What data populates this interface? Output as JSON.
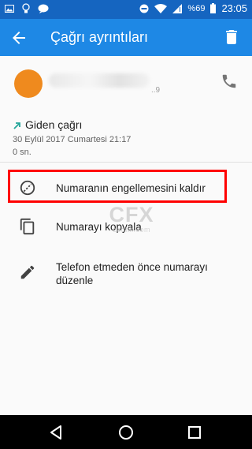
{
  "status_bar": {
    "battery_percent": "%69",
    "time": "23:05",
    "icons": [
      "image-icon",
      "lightbulb-icon",
      "messenger-icon",
      "do-not-disturb-icon",
      "wifi-icon",
      "signal-icon",
      "battery-icon"
    ]
  },
  "app_bar": {
    "title": "Çağrı ayrıntıları",
    "back_icon": "arrow-back-icon",
    "delete_icon": "trash-icon"
  },
  "contact": {
    "avatar_color": "#ef8a1e",
    "number_partial": "..9"
  },
  "call": {
    "type": "Giden çağrı",
    "type_color": "#26a69a",
    "date": "30 Eylül 2017 Cumartesi 21:17",
    "duration": "0 sn."
  },
  "actions": [
    {
      "label": "Numaranın engellemesini kaldır",
      "icon": "unblock-icon",
      "highlighted": true
    },
    {
      "label": "Numarayı kopyala",
      "icon": "copy-icon"
    },
    {
      "label": "Telefon etmeden önce numarayı düzenle",
      "icon": "edit-pencil-icon"
    }
  ],
  "watermark": {
    "logo": "CFX",
    "site": "ceofix.com"
  },
  "nav_bar": {
    "back": "nav-back-icon",
    "home": "nav-home-icon",
    "recents": "nav-recents-icon"
  },
  "colors": {
    "status_bar": "#1565c0",
    "app_bar": "#1e88e5",
    "highlight": "#ff0000"
  }
}
